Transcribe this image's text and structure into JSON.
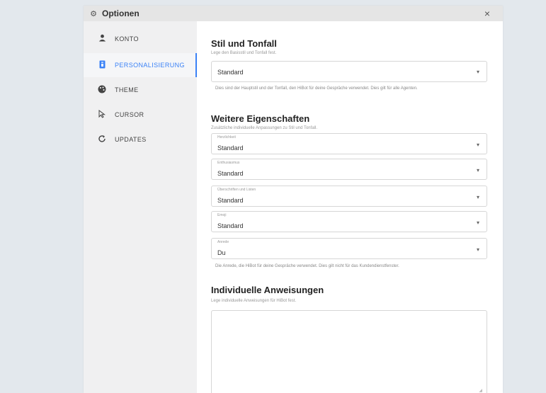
{
  "window": {
    "title": "Optionen",
    "title_icon": "gear-icon",
    "close_glyph": "×"
  },
  "sidebar": {
    "items": [
      {
        "label": "KONTO",
        "icon": "user-icon",
        "glyph": "👤"
      },
      {
        "label": "PERSONALISIERUNG",
        "icon": "personalization-icon",
        "glyph": "▮",
        "active": true
      },
      {
        "label": "THEME",
        "icon": "palette-icon",
        "glyph": "◕"
      },
      {
        "label": "CURSOR",
        "icon": "cursor-icon",
        "glyph": "⌖"
      },
      {
        "label": "UPDATES",
        "icon": "refresh-icon",
        "glyph": "↻"
      }
    ]
  },
  "style_section": {
    "heading": "Stil und Tonfall",
    "subtitle": "Lege den Basisstil und Tonfall fest.",
    "select_value": "Standard",
    "help": "Dies sind der Hauptstil und der Tonfall, den HiBot für deine Gespräche verwendet. Dies gilt für alle Agenten."
  },
  "properties_section": {
    "heading": "Weitere Eigenschaften",
    "subtitle": "Zusätzliche individuelle Anpassungen zu Stil und Tonfall.",
    "fields": [
      {
        "label": "Herzlichkeit",
        "value": "Standard"
      },
      {
        "label": "Enthusiasmus",
        "value": "Standard"
      },
      {
        "label": "Überschriften und Listen",
        "value": "Standard"
      },
      {
        "label": "Emoji",
        "value": "Standard"
      },
      {
        "label": "Anrede",
        "value": "Du"
      }
    ],
    "help": "Die Anrede, die HiBot für deine Gespräche verwendet. Dies gilt nicht für das Kundendienstfenster."
  },
  "instructions_section": {
    "heading": "Individuelle Anweisungen",
    "subtitle": "Lege individuelle Anweisungen für HiBot fest."
  },
  "colors": {
    "accent": "#3b82f6",
    "background": "#e3e8ed",
    "sidebar": "#f0f0f1",
    "titlebar": "#e5e5e5"
  }
}
